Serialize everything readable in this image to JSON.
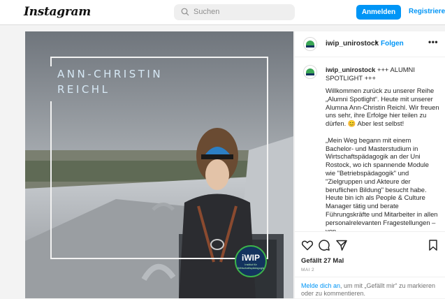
{
  "header": {
    "logo": "Instagram",
    "search_placeholder": "Suchen",
    "login_label": "Anmelden",
    "register_label": "Registrieren"
  },
  "post": {
    "overlay_name_line1": "ANN-CHRISTIN",
    "overlay_name_line2": "REICHL",
    "badge_title": "iWIP",
    "badge_subtitle": "Institut für Wirtschaftspädagogik",
    "author": "iwip_unirostock",
    "follow_label": "Folgen",
    "separator": "•",
    "more_label": "•••",
    "caption_head_user": "iwip_unirostock",
    "caption_head_text": "+++ ALUMNI SPOTLIGHT +++",
    "caption_body": "Willkommen zurück zu unserer Reihe „Alumni Spotlight“. Heute mit unserer Alumna Ann-Christin Reichl. Wir freuen uns sehr, ihre Erfolge hier teilen zu dürfen. 😊 Aber lest selbst!\n\n„Mein Weg begann mit einem Bachelor- und Masterstudium in Wirtschaftspädagogik an der Uni Rostock, wo ich spannende Module wie \"Betriebspädagogik\" und \"Zielgruppen und Akteure der beruflichen Bildung\" besucht habe. Heute bin ich als People & Culture Manager tätig und berate Führungskräfte und Mitarbeiter in allen personalrelevanten Fragestellungen – von",
    "likes": "Gefällt 27 Mal",
    "date": "MAI 2",
    "login_note_link": "Melde dich an",
    "login_note_text": ", um mit „Gefällt mir“ zu markieren oder zu kommentieren."
  },
  "icons": [
    "search-icon",
    "heart-icon",
    "comment-icon",
    "share-icon",
    "bookmark-icon"
  ],
  "colors": {
    "accent": "#0095f6",
    "overlay_text": "#d6e8f5",
    "badge_bg": "#13335e",
    "badge_ring": "#3cb44a"
  }
}
